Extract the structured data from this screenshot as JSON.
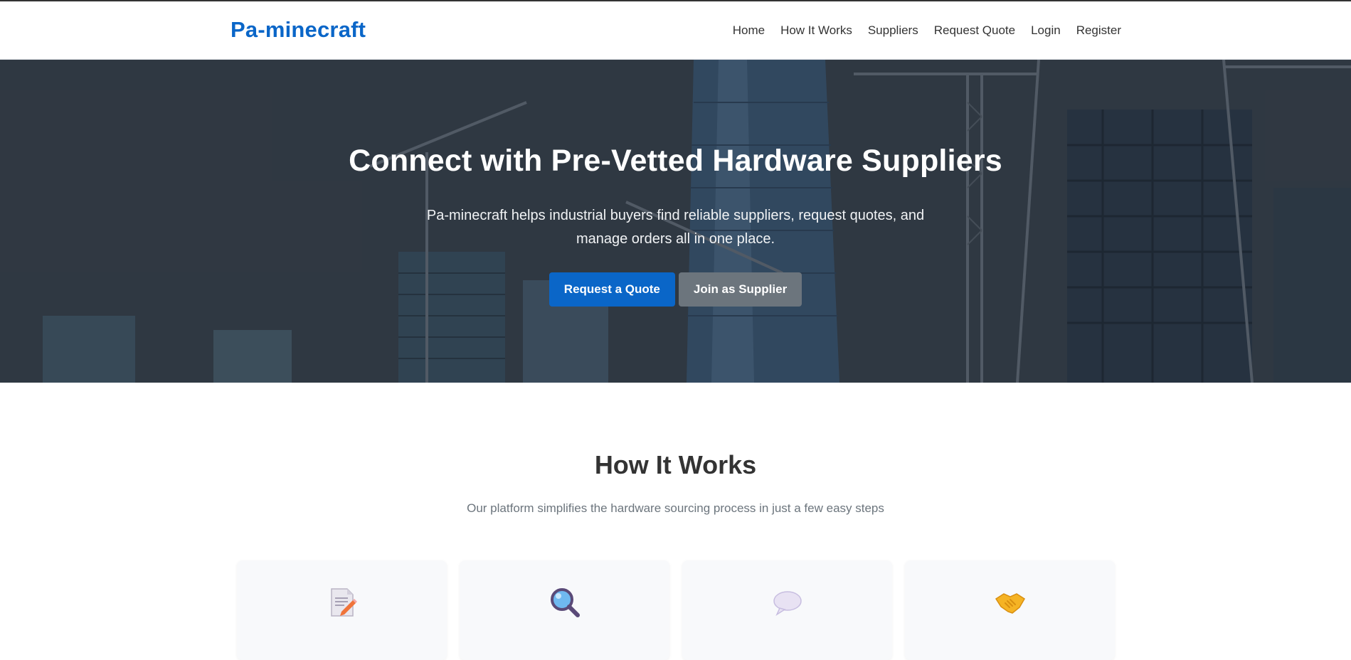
{
  "header": {
    "brand": "Pa-minecraft",
    "nav": [
      "Home",
      "How It Works",
      "Suppliers",
      "Request Quote",
      "Login",
      "Register"
    ]
  },
  "hero": {
    "title": "Connect with Pre-Vetted Hardware Suppliers",
    "subtitle": "Pa-minecraft helps industrial buyers find reliable suppliers, request quotes, and manage orders all in one place.",
    "primary_button": "Request a Quote",
    "secondary_button": "Join as Supplier"
  },
  "how_it_works": {
    "title": "How It Works",
    "subtitle": "Our platform simplifies the hardware sourcing process in just a few easy steps",
    "cards": [
      {
        "icon": "memo-icon"
      },
      {
        "icon": "magnifier-icon"
      },
      {
        "icon": "speech-bubble-icon"
      },
      {
        "icon": "handshake-icon"
      }
    ]
  },
  "colors": {
    "brand": "#0a66c8",
    "primary_button": "#0a66c8",
    "secondary_button": "#6c757d",
    "text": "#333333",
    "muted": "#6c757d"
  }
}
